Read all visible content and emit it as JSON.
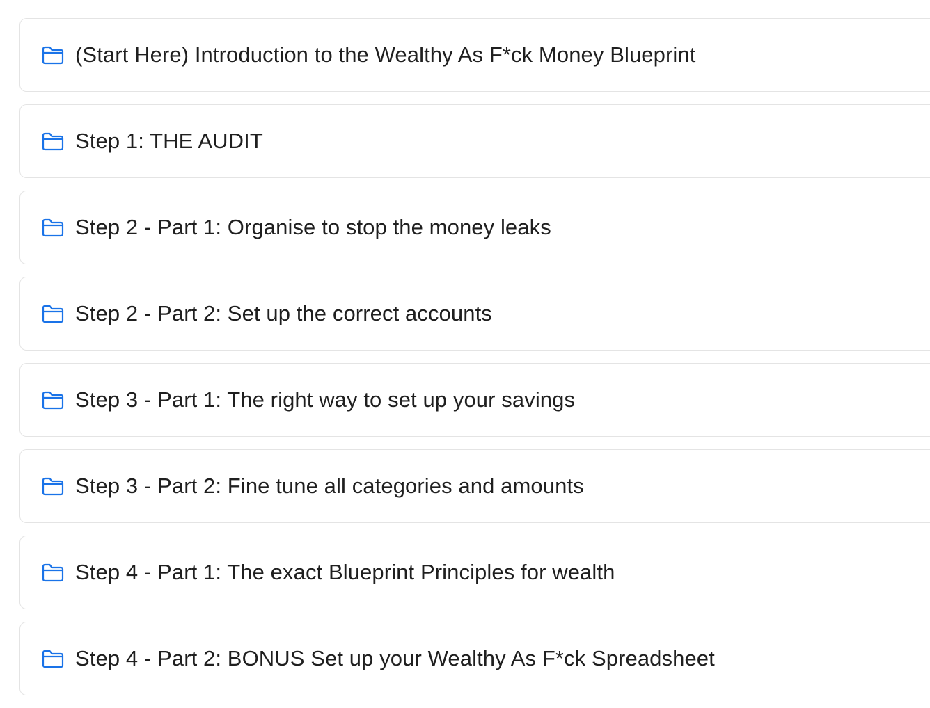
{
  "accent_color": "#1a73e8",
  "modules": [
    {
      "icon": "folder-icon",
      "title": "(Start Here) Introduction to the Wealthy As F*ck Money Blueprint"
    },
    {
      "icon": "folder-icon",
      "title": "Step 1: THE AUDIT"
    },
    {
      "icon": "folder-icon",
      "title": "Step 2 - Part 1: Organise to stop the money leaks"
    },
    {
      "icon": "folder-icon",
      "title": "Step 2 - Part 2: Set up the correct accounts"
    },
    {
      "icon": "folder-icon",
      "title": "Step 3 - Part 1: The right way to set up your savings"
    },
    {
      "icon": "folder-icon",
      "title": "Step 3 - Part 2: Fine tune all categories and amounts"
    },
    {
      "icon": "folder-icon",
      "title": "Step 4 - Part 1: The exact Blueprint Principles for wealth"
    },
    {
      "icon": "folder-icon",
      "title": "Step 4 - Part 2: BONUS Set up your Wealthy As F*ck Spreadsheet"
    }
  ]
}
